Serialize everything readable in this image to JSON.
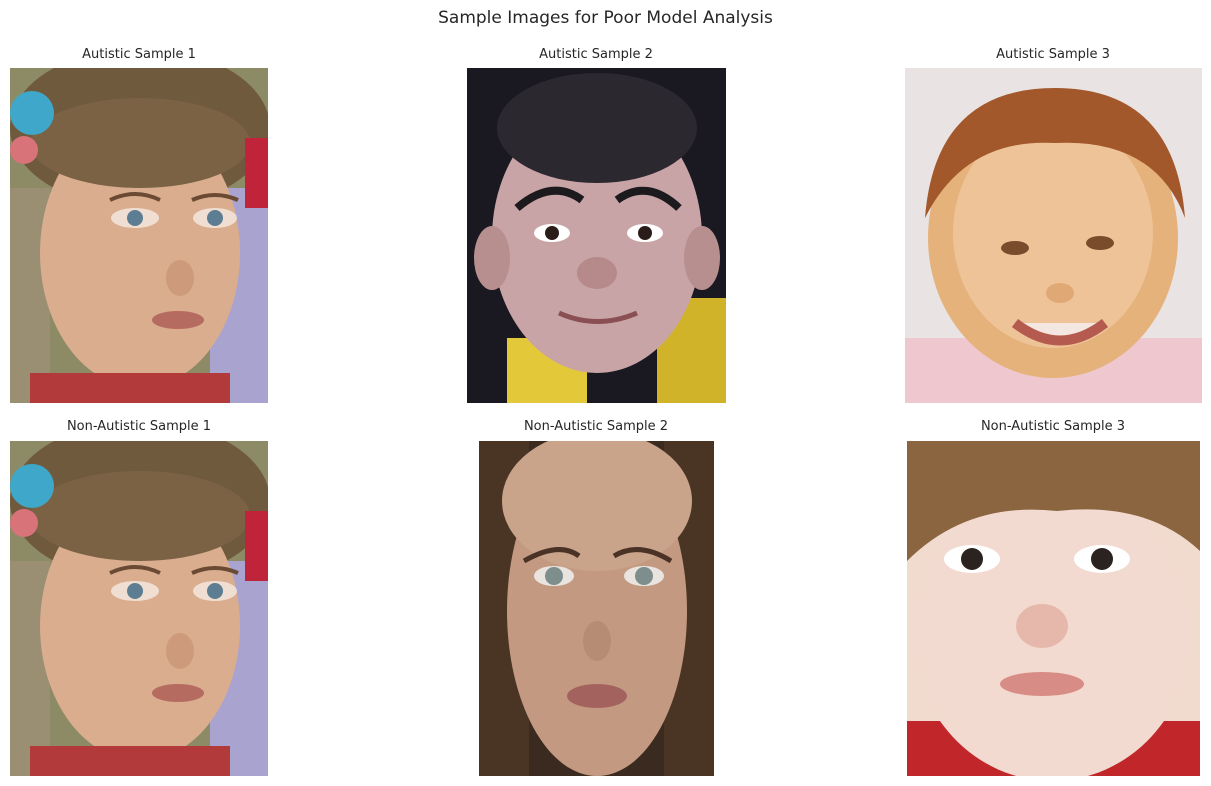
{
  "figure": {
    "title": "Sample Images for Poor Model Analysis"
  },
  "panels": [
    {
      "title": "Autistic Sample 1",
      "image": "child-face-photo-girl-light-brown-hair"
    },
    {
      "title": "Autistic Sample 2",
      "image": "child-face-photo-boy-short-dark-hair"
    },
    {
      "title": "Autistic Sample 3",
      "image": "child-face-photo-toddler-ginger-hair"
    },
    {
      "title": "Non-Autistic Sample 1",
      "image": "child-face-photo-girl-light-brown-hair"
    },
    {
      "title": "Non-Autistic Sample 2",
      "image": "child-face-photo-girl-long-brown-hair"
    },
    {
      "title": "Non-Autistic Sample 3",
      "image": "child-face-photo-boy-brown-fringe"
    }
  ],
  "colors": {
    "background": "#ffffff",
    "text": "#262626"
  }
}
